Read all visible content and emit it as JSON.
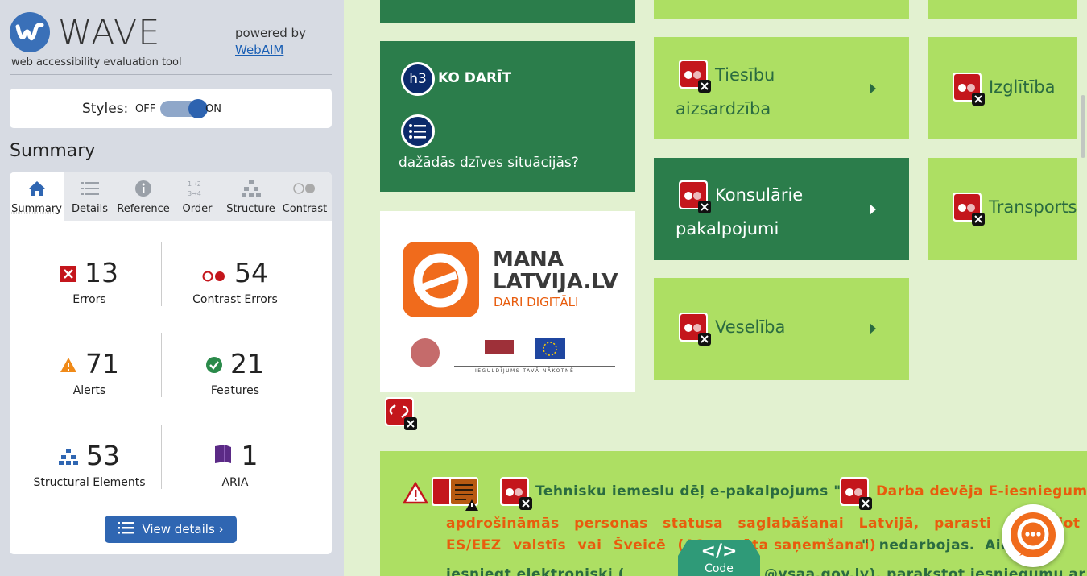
{
  "wave": {
    "logo_text": "WAVE",
    "tagline": "web accessibility evaluation tool",
    "powered_by": "powered by",
    "webaim_link": "WebAIM",
    "styles_label": "Styles:",
    "styles_off": "OFF",
    "styles_on": "ON",
    "summary_title": "Summary",
    "tabs": [
      {
        "label": "Summary",
        "icon": "home-icon"
      },
      {
        "label": "Details",
        "icon": "list-icon"
      },
      {
        "label": "Reference",
        "icon": "info-icon"
      },
      {
        "label": "Order",
        "icon": "order-icon"
      },
      {
        "label": "Structure",
        "icon": "structure-icon"
      },
      {
        "label": "Contrast",
        "icon": "contrast-icon"
      }
    ],
    "stats": {
      "errors": {
        "value": "13",
        "label": "Errors"
      },
      "contrast": {
        "value": "54",
        "label": "Contrast Errors"
      },
      "alerts": {
        "value": "71",
        "label": "Alerts"
      },
      "features": {
        "value": "21",
        "label": "Features"
      },
      "structural": {
        "value": "53",
        "label": "Structural Elements"
      },
      "aria": {
        "value": "1",
        "label": "ARIA"
      }
    },
    "view_details": "View details ›"
  },
  "page": {
    "h3_badge": "h3",
    "ko_darit": "KO DARĪT",
    "situations": "dažādās dzīves situācijās?",
    "tiles": {
      "tiesibu_line1": "Tiesību",
      "tiesibu_line2": "aizsardzība",
      "izglitiba": "Izglītība",
      "konsularie_line1": "Konsulārie",
      "konsularie_line2": "pakalpojumi",
      "transports": "Transports",
      "veseliba": "Veselība"
    },
    "ad": {
      "line1": "MANA",
      "line2": "LATVIJA.LV",
      "line3": "DARI DIGITĀLI",
      "footer": "IEGULDĪJUMS TAVĀ NĀKOTNĒ"
    },
    "notice": {
      "p1": "Tehnisku iemeslu dēļ e-pakalpojums \"",
      "p2": "Darba devēja E-iesniegums",
      "p3": "apdrošināmās personas statusa saglabāšanai Latvijā, parasti strādājot d",
      "p4": "ES/EEZ valstīs vai Šveicē (A1 se",
      "p5": "āta saņemšanai)",
      "p6": "\" nedarbojas. Aici",
      "p7": "iesniegt elektroniski (",
      "p8": "@vsaa.gov.lv), parakstot iesniegumu ar e"
    },
    "code_label": "Code"
  },
  "colors": {
    "dark_tile": "#2b7d4b",
    "light_tile": "#addf63",
    "error_red": "#c4161c",
    "wave_blue": "#2f66b2",
    "orange": "#e85c0d"
  }
}
